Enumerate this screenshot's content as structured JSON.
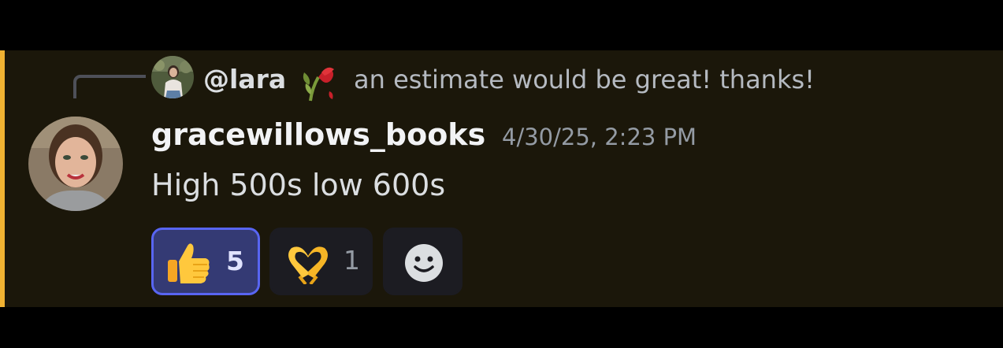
{
  "reply": {
    "username": "@lara",
    "flair": "wilted-rose-emoji",
    "text": "an estimate would be great! thanks!"
  },
  "message": {
    "author": "gracewillows_books",
    "timestamp": "4/30/25, 2:23 PM",
    "content": "High 500s low 600s"
  },
  "reactions": [
    {
      "emoji": "thumbs-up",
      "count": "5",
      "active": true
    },
    {
      "emoji": "heart-hands",
      "count": "1",
      "active": false
    }
  ],
  "add_reaction_icon": "smiley-face-icon",
  "colors": {
    "mention_accent": "#f0b232",
    "message_bg": "#1b170a",
    "active_reaction_border": "#5865f2",
    "active_reaction_bg": "#343a74"
  }
}
